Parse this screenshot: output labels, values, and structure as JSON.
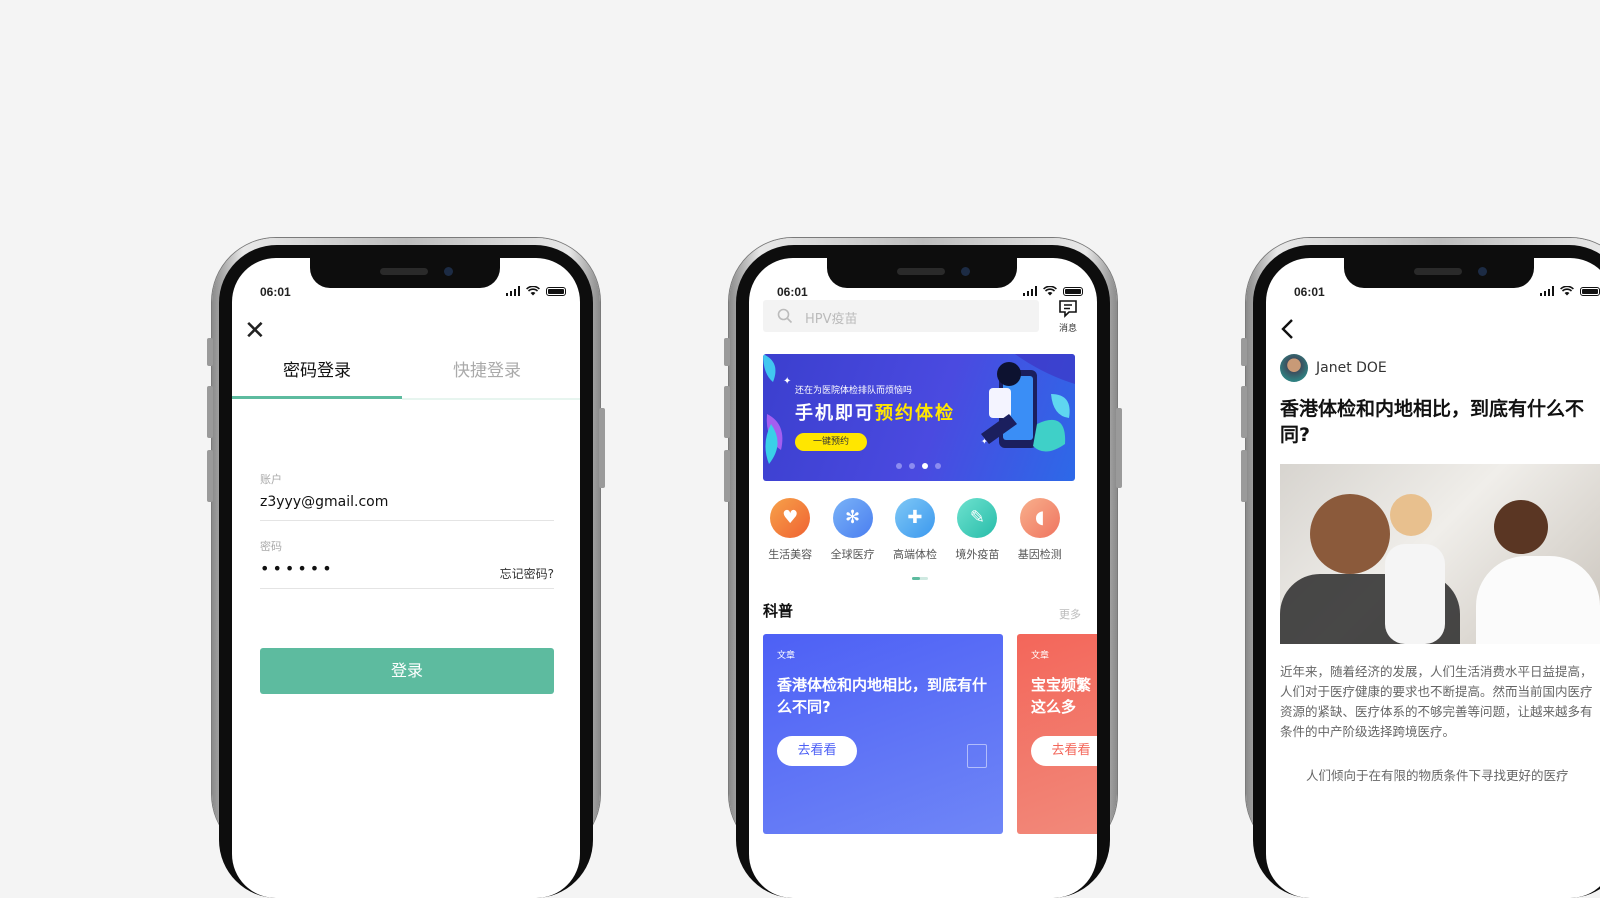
{
  "status": {
    "time": "06:01"
  },
  "login": {
    "close_icon": "close-icon",
    "tabs": [
      {
        "label": "密码登录"
      },
      {
        "label": "快捷登录"
      }
    ],
    "account_label": "账户",
    "account_value": "z3yyy@gmail.com",
    "password_label": "密码",
    "password_value": "••••••",
    "forgot_label": "忘记密码?",
    "submit_label": "登录",
    "accent_color": "#5dbb9f"
  },
  "home": {
    "search_placeholder": "HPV疫苗",
    "message_label": "消息",
    "banner": {
      "subtitle": "还在为医院体检排队而烦恼吗",
      "title_part1": "手机即可",
      "title_part2": "预约体检",
      "button_label": "一键预约"
    },
    "categories": [
      {
        "label": "生活美容",
        "icon": "heart-icon",
        "color": "#f0703a"
      },
      {
        "label": "全球医疗",
        "icon": "gear-icon",
        "color": "#5b8ef3"
      },
      {
        "label": "高端体检",
        "icon": "medkit-icon",
        "color": "#4aa8f0"
      },
      {
        "label": "境外疫苗",
        "icon": "syringe-icon",
        "color": "#35c7b5"
      },
      {
        "label": "基因检测",
        "icon": "tooth-icon",
        "color": "#f2856a"
      }
    ],
    "section_title": "科普",
    "section_more": "更多",
    "cards": [
      {
        "kind": "文章",
        "title": "香港体检和内地相比，到底有什么不同?",
        "action": "去看看"
      },
      {
        "kind": "文章",
        "title": "宝宝频繁这么多",
        "action": "去看看"
      }
    ]
  },
  "article": {
    "back_icon": "chevron-left-icon",
    "author": "Janet DOE",
    "title": "香港体检和内地相比，到底有什么不同?",
    "paragraph1": "近年来，随着经济的发展，人们生活消费水平日益提高，人们对于医疗健康的要求也不断提高。然而当前国内医疗资源的紧缺、医疗体系的不够完善等问题，让越来越多有条件的中产阶级选择跨境医疗。",
    "paragraph2": "人们倾向于在有限的物质条件下寻找更好的医疗"
  }
}
